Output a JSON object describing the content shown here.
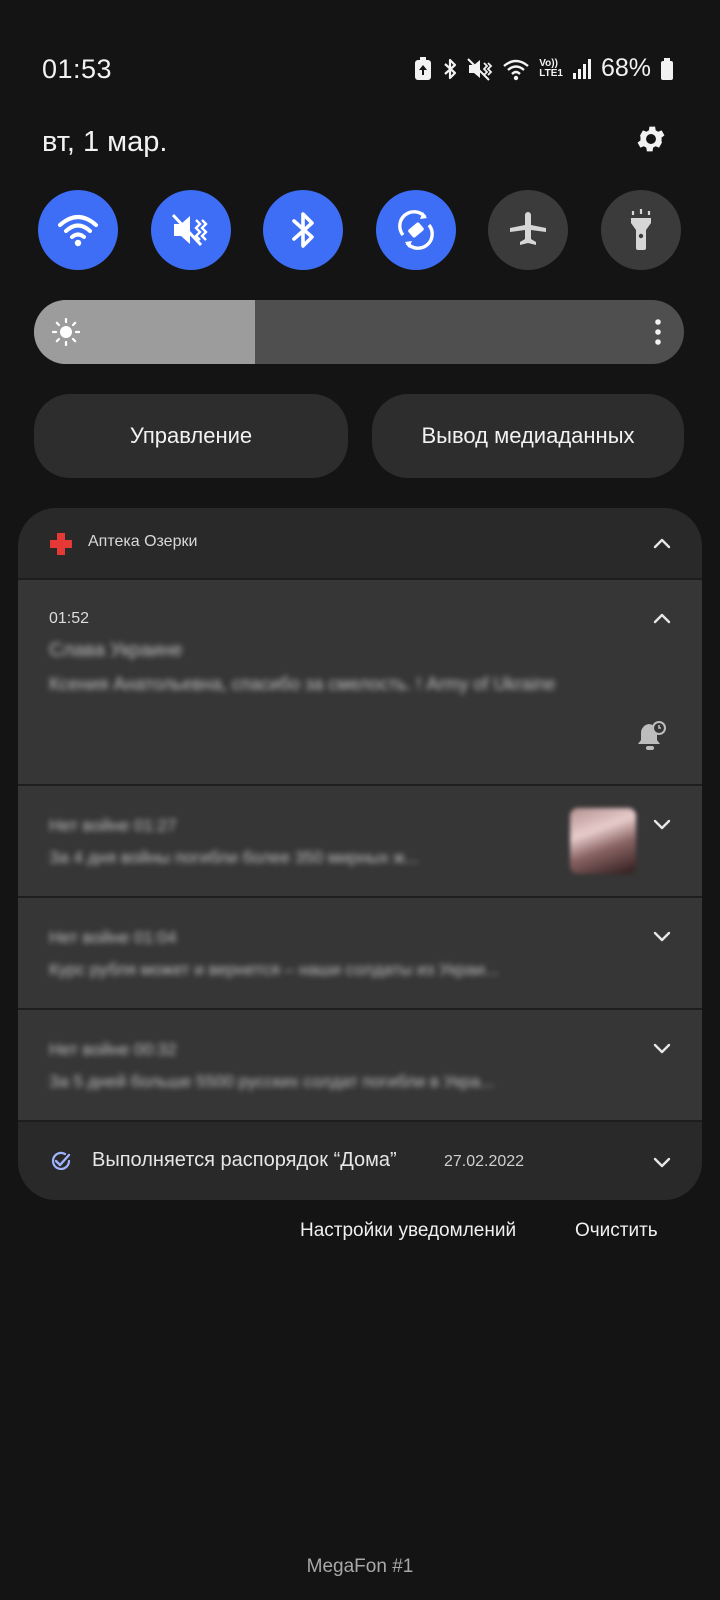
{
  "status_bar": {
    "time": "01:53",
    "battery": "68%",
    "network_label_top": "Vo))",
    "network_label_bottom": "LTE1"
  },
  "header": {
    "date": "вт, 1 мар."
  },
  "quick_settings": [
    {
      "name": "wifi",
      "icon": "wifi-icon",
      "active": true
    },
    {
      "name": "sound",
      "icon": "mute-vibrate-icon",
      "active": true
    },
    {
      "name": "bluetooth",
      "icon": "bluetooth-icon",
      "active": true
    },
    {
      "name": "auto-rotate",
      "icon": "auto-rotate-icon",
      "active": true
    },
    {
      "name": "airplane",
      "icon": "airplane-icon",
      "active": false
    },
    {
      "name": "flashlight",
      "icon": "flashlight-icon",
      "active": false
    }
  ],
  "brightness": {
    "level": 0.34
  },
  "buttons": {
    "control": "Управление",
    "media": "Вывод медиаданных"
  },
  "notification_group": {
    "app_name": "Аптека Озерки",
    "first": {
      "time": "01:52",
      "title": "Слава Украине",
      "body": "Ксения Анатольевна, спасибо за смелость. ! Army of Ukraine"
    },
    "rows": [
      {
        "title": "Нет войне  01:27",
        "body": "За 4 дня войны погибли более 350 мирных ж..."
      },
      {
        "title": "Нет войне  01:04",
        "body": "Курс рубля может и вернется – наши солдаты из Украи..."
      },
      {
        "title": "Нет войне  00:32",
        "body": "За 5 дней больше 5500 русских солдат погибли в Укра..."
      }
    ]
  },
  "routine": {
    "text": "Выполняется распорядок “Дома”",
    "date": "27.02.2022"
  },
  "footer": {
    "settings": "Настройки уведомлений",
    "clear": "Очистить",
    "carrier": "MegaFon #1"
  },
  "colors": {
    "accent": "#3d6ef5",
    "background": "#141414",
    "panel": "#292929",
    "card": "#363636",
    "app_icon": "#e53935"
  }
}
